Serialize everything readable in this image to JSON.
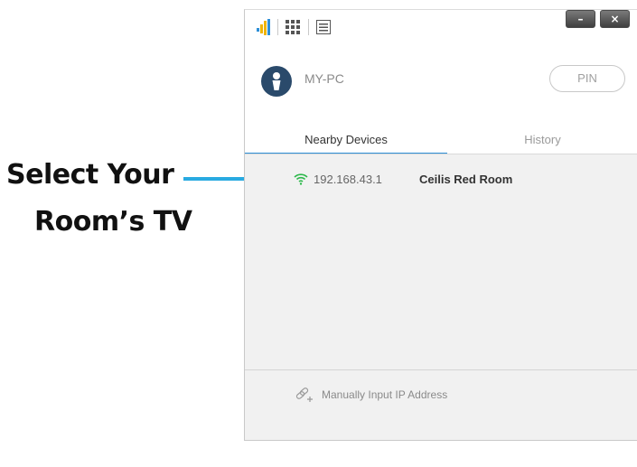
{
  "annotation": {
    "line1": "Select Your",
    "line2": "Room’s TV",
    "arrow_color": "#29aae1"
  },
  "window": {
    "titlebar": {
      "app_icon": "signal-bars-icon",
      "grid_icon": "grid-icon",
      "menu_icon": "list-icon",
      "minimize_label": "–",
      "close_label": "×"
    },
    "profile": {
      "icon": "keyhole-icon",
      "device_name": "MY-PC"
    },
    "pin_button": "PIN",
    "tabs": [
      {
        "label": "Nearby Devices",
        "active": true
      },
      {
        "label": "History",
        "active": false
      }
    ],
    "devices": [
      {
        "icon": "wifi-icon",
        "ip": "192.168.43.1",
        "name": "Ceilis Red Room"
      }
    ],
    "footer": {
      "icon": "link-add-icon",
      "label": "Manually Input IP Address"
    }
  },
  "colors": {
    "accent_blue": "#2e8fd6",
    "wifi_green": "#2db84b",
    "list_background": "#f1f1f1"
  }
}
